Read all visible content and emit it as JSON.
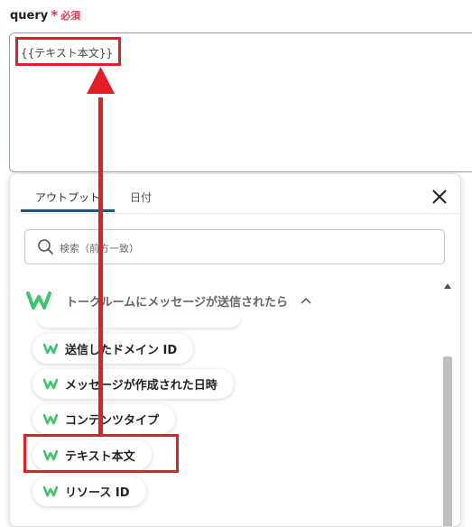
{
  "field": {
    "name": "query",
    "required_star": "*",
    "required_text": "必須",
    "value": "{{テキスト本文}}"
  },
  "popup": {
    "tabs": [
      {
        "label": "アウトプット",
        "active": true
      },
      {
        "label": "日付",
        "active": false
      }
    ],
    "search_placeholder": "検索（前方一致）",
    "group": {
      "title": "トークルームにメッセージが送信されたら"
    },
    "items": [
      {
        "label": "送信したドメイン ID"
      },
      {
        "label": "メッセージが作成された日時"
      },
      {
        "label": "コンテンツタイプ"
      },
      {
        "label": "テキスト本文"
      },
      {
        "label": "リソース ID"
      }
    ]
  },
  "colors": {
    "required": "#e8364d",
    "annotation": "#e41e24",
    "tab_underline": "#1f5673",
    "brand_green": "#3cc66a"
  },
  "icons": {
    "close": "close-icon",
    "search": "search-icon",
    "brand": "w-logo-icon",
    "collapse": "chevron-up-icon"
  }
}
